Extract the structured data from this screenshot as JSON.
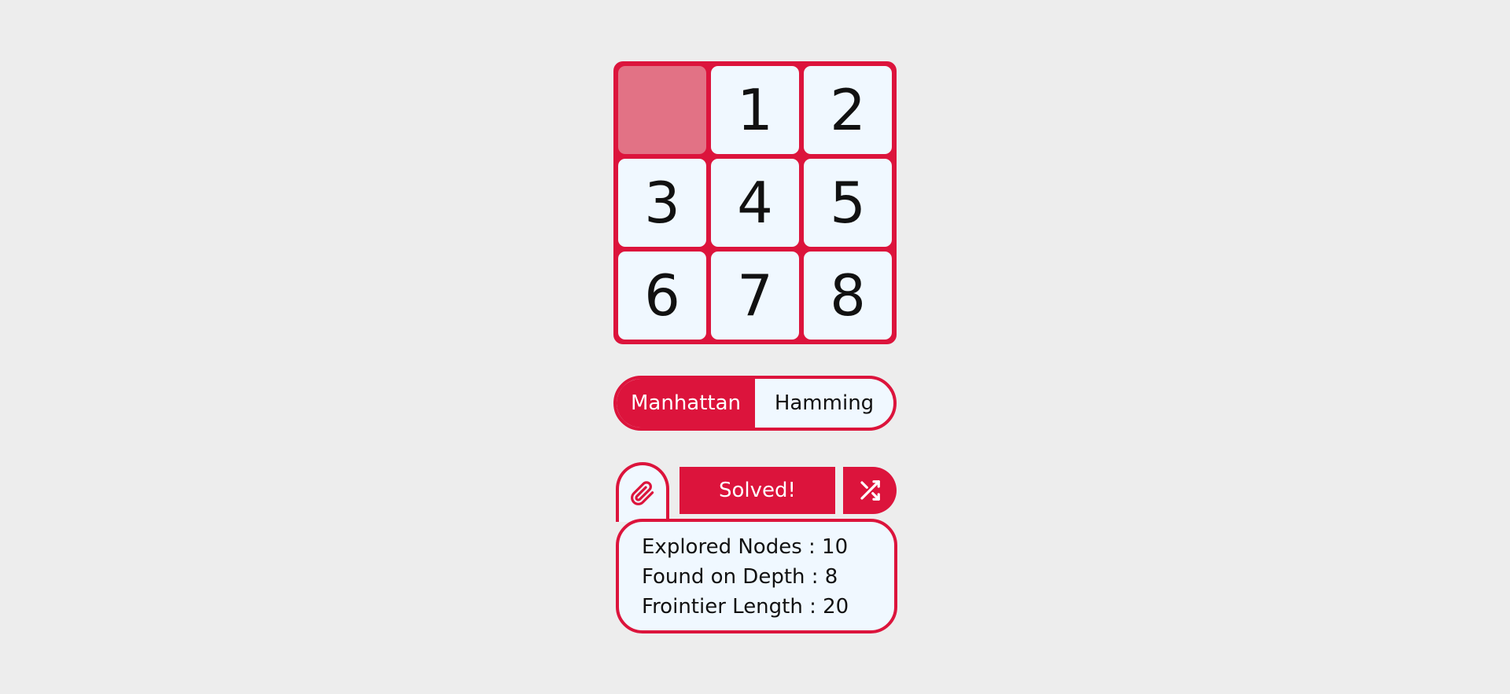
{
  "board": {
    "tiles": [
      "",
      "1",
      "2",
      "3",
      "4",
      "5",
      "6",
      "7",
      "8"
    ]
  },
  "heuristic": {
    "options": [
      "Manhattan",
      "Hamming"
    ],
    "selected": "Manhattan"
  },
  "controls": {
    "solve_label": "Solved!"
  },
  "stats": {
    "explored_nodes": "Explored Nodes : 10",
    "found_on_depth": "Found on Depth : 8",
    "frontier_length": "Frointier Length : 20"
  },
  "icons": {
    "tab": "paperclip-icon",
    "shuffle": "shuffle-icon"
  },
  "colors": {
    "accent": "#dc143c",
    "tile": "#f0f8ff",
    "empty_tile": "#e27285",
    "background": "#ededed"
  }
}
